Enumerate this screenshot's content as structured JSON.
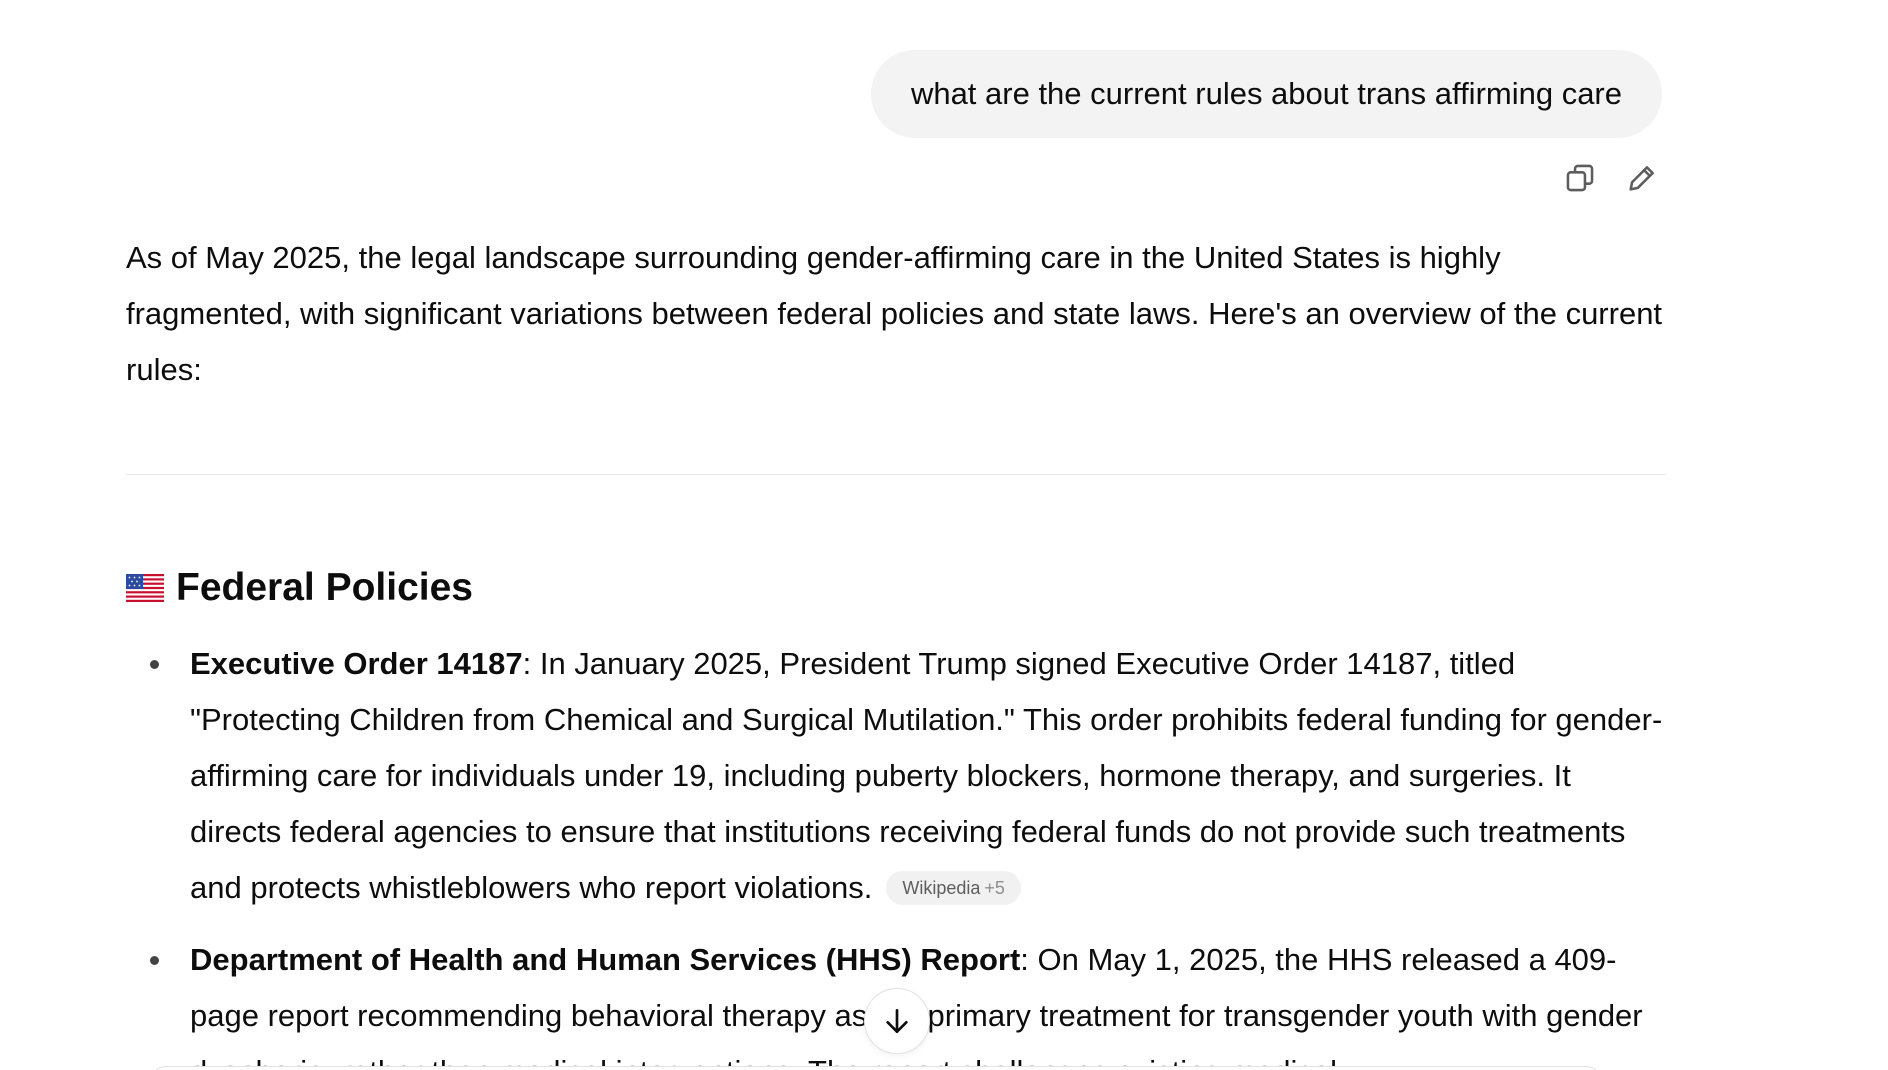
{
  "user_message": {
    "text": "what are the current rules about trans affirming care"
  },
  "user_actions": {
    "copy_icon": "copy-icon",
    "edit_icon": "pencil-icon"
  },
  "answer": {
    "intro": "As of May 2025, the legal landscape surrounding gender-affirming care in the United States is highly fragmented, with significant variations between federal policies and state laws. Here's an overview of the current rules:",
    "section": {
      "emoji": "us-flag",
      "title": "Federal Policies"
    },
    "bullets": [
      {
        "heading": "Executive Order 14187",
        "body": ": In January 2025, President Trump signed Executive Order 14187, titled \"Protecting Children from Chemical and Surgical Mutilation.\" This order prohibits federal funding for gender-affirming care for individuals under 19, including puberty blockers, hormone therapy, and surgeries. It directs federal agencies to ensure that institutions receiving federal funds do not provide such treatments and protects whistleblowers who report violations.",
        "citation": {
          "source": "Wikipedia",
          "more": "+5"
        }
      },
      {
        "heading": "Department of Health and Human Services (HHS) Report",
        "body": ": On May 1, 2025, the HHS released a 409-page report recommending behavioral therapy as the primary treatment for transgender youth with gender dysphoria, rather than medical interventions. The report challenges existing medical"
      }
    ]
  },
  "scroll_button": {
    "icon": "arrow-down-icon"
  },
  "colors": {
    "bubble_bg": "#f3f3f3",
    "text": "#0d0d0d",
    "divider": "#e5e5e5",
    "citation_bg": "#f1f1f1"
  }
}
